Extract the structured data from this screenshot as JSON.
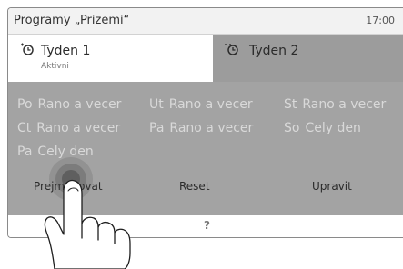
{
  "header": {
    "title": "Programy „Prizemi“",
    "clock": "17:00"
  },
  "tabs": [
    {
      "label": "Tyden 1",
      "sublabel": "Aktivni",
      "active": true,
      "icon": "timer-icon"
    },
    {
      "label": "Tyden 2",
      "active": false,
      "icon": "timer-icon"
    }
  ],
  "schedule": [
    [
      {
        "day": "Po",
        "program": "Rano a vecer"
      },
      {
        "day": "Ut",
        "program": "Rano a vecer"
      },
      {
        "day": "St",
        "program": "Rano a vecer"
      }
    ],
    [
      {
        "day": "Ct",
        "program": "Rano a vecer"
      },
      {
        "day": "Pa",
        "program": "Rano a vecer"
      },
      {
        "day": "So",
        "program": "Cely den"
      }
    ],
    [
      {
        "day": "Pa",
        "program": "Cely den"
      }
    ]
  ],
  "actions": {
    "rename": "Prejmenovat",
    "reset": "Reset",
    "edit": "Upravit"
  },
  "help": {
    "label": "?"
  },
  "colors": {
    "overlay": "#a3a3a3",
    "header_bg": "#f2f2f2",
    "tab_active_bg": "#ffffff",
    "text_dim": "#d9d9d9"
  }
}
